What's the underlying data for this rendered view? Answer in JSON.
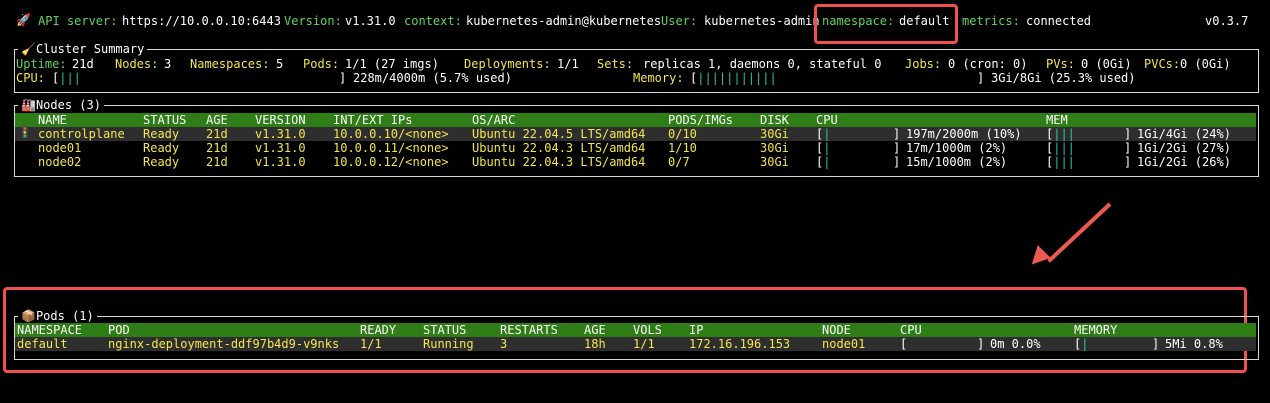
{
  "topbar": {
    "api_label": "API server:",
    "api_value": "https://10.0.0.10:6443",
    "version_label": "Version:",
    "version_value": "v1.31.0",
    "context_label": "context:",
    "context_value": "kubernetes-admin@kubernetes",
    "user_label": "User:",
    "user_value": "kubernetes-admin",
    "namespace_label": "namespace:",
    "namespace_value": "default",
    "metrics_label": "metrics:",
    "metrics_value": "connected",
    "app_version": "v0.3.7"
  },
  "cluster": {
    "title": "Cluster Summary",
    "uptime_label": "Uptime:",
    "uptime_value": "21d",
    "nodes_label": "Nodes:",
    "nodes_value": "3",
    "namespaces_label": "Namespaces:",
    "namespaces_value": "5",
    "pods_label": "Pods:",
    "pods_value": "1/1 (27 imgs)",
    "deployments_label": "Deployments:",
    "deployments_value": "1/1",
    "sets_label": "Sets:",
    "sets_value": "replicas 1, daemons 0, stateful 0",
    "jobs_label": "Jobs:",
    "jobs_value": "0 (cron: 0)",
    "pvs_label": "PVs:",
    "pvs_value": "0 (0Gi)",
    "pvcs_label": "PVCs:",
    "pvcs_value": "0 (0Gi)",
    "cpu_label": "CPU:",
    "cpu_bar_open": "[",
    "cpu_bar_fill": "|||",
    "cpu_bar_close": "]",
    "cpu_value": "228m/4000m (5.7% used)",
    "memory_label": "Memory:",
    "mem_bar_open": "[",
    "mem_bar_fill": "|||||||||||",
    "mem_bar_close": "]",
    "memory_value": "3Gi/8Gi (25.3% used)"
  },
  "nodes": {
    "title": "Nodes (3)",
    "headers": [
      "NAME",
      "STATUS",
      "AGE",
      "VERSION",
      "INT/EXT IPs",
      "OS/ARC",
      "PODS/IMGs",
      "DISK",
      "CPU",
      "MEM"
    ],
    "rows": [
      {
        "name": "controlplane",
        "status": "Ready",
        "age": "21d",
        "version": "v1.31.0",
        "ips": "10.0.0.10/<none>",
        "os": "Ubuntu 22.04.5 LTS/amd64",
        "pods": "0/10",
        "disk": "30Gi",
        "cpu_open": "[",
        "cpu_fill": "|",
        "cpu_close": "]",
        "cpu_value": "197m/2000m (10%)",
        "mem_open": "[",
        "mem_fill": "|||",
        "mem_close": "]",
        "mem_value": "1Gi/4Gi (24%)"
      },
      {
        "name": "node01",
        "status": "Ready",
        "age": "21d",
        "version": "v1.31.0",
        "ips": "10.0.0.11/<none>",
        "os": "Ubuntu 22.04.3 LTS/amd64",
        "pods": "1/10",
        "disk": "30Gi",
        "cpu_open": "[",
        "cpu_fill": "|",
        "cpu_close": "]",
        "cpu_value": "17m/1000m (2%)",
        "mem_open": "[",
        "mem_fill": "|||",
        "mem_close": "]",
        "mem_value": "1Gi/2Gi (27%)"
      },
      {
        "name": "node02",
        "status": "Ready",
        "age": "21d",
        "version": "v1.31.0",
        "ips": "10.0.0.12/<none>",
        "os": "Ubuntu 22.04.3 LTS/amd64",
        "pods": "0/7",
        "disk": "30Gi",
        "cpu_open": "[",
        "cpu_fill": "|",
        "cpu_close": "]",
        "cpu_value": "15m/1000m (2%)",
        "mem_open": "[",
        "mem_fill": "|||",
        "mem_close": "]",
        "mem_value": "1Gi/2Gi (26%)"
      }
    ]
  },
  "pods": {
    "title": "Pods (1)",
    "headers": [
      "NAMESPACE",
      "POD",
      "READY",
      "STATUS",
      "RESTARTS",
      "AGE",
      "VOLS",
      "IP",
      "NODE",
      "CPU",
      "MEMORY"
    ],
    "rows": [
      {
        "namespace": "default",
        "pod": "nginx-deployment-ddf97b4d9-v9nks",
        "ready": "1/1",
        "status": "Running",
        "restarts": "3",
        "age": "18h",
        "vols": "1/1",
        "ip": "172.16.196.153",
        "node": "node01",
        "cpu_open": "[",
        "cpu_close": "]",
        "cpu_value": "0m 0.0%",
        "mem_open": "[",
        "mem_fill": "|",
        "mem_close": "]",
        "mem_value": "5Mi 0.8%"
      }
    ]
  },
  "colors": {
    "accent_red": "#f0504f",
    "header_green": "#2f7d16",
    "label_green": "#5fd35f",
    "value_yellow": "#f2e64b"
  },
  "icons": {
    "app": "rocket-icon",
    "cluster": "broom-icon",
    "nodes": "factory-icon",
    "pods": "package-icon",
    "node_status": "traffic-light-icon"
  }
}
